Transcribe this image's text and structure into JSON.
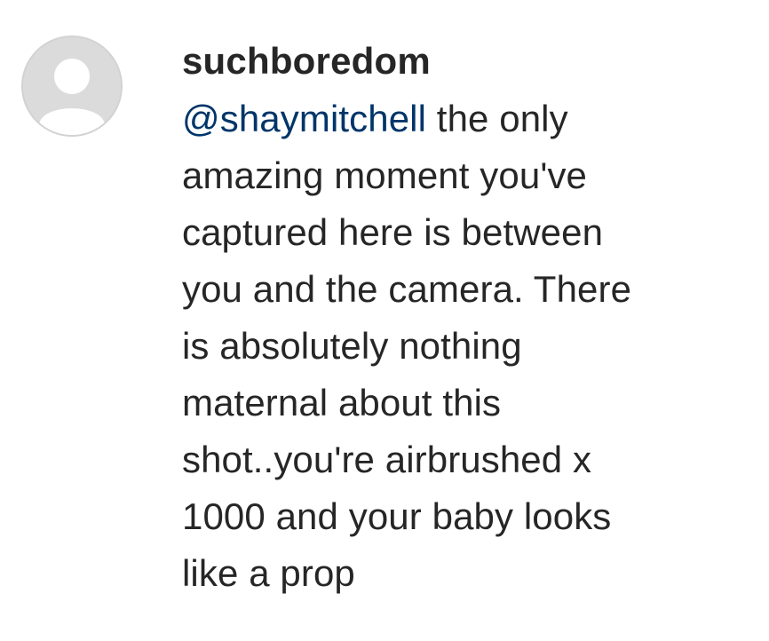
{
  "comment": {
    "username": "suchboredom",
    "mention": "@shaymitchell",
    "first_line_rest": " the only",
    "lines": [
      "amazing moment you've",
      "captured here is between",
      "you and the camera. There",
      "is absolutely nothing",
      "maternal about this",
      "shot..you're airbrushed x",
      "1000 and your baby looks",
      "like a prop"
    ]
  },
  "avatar": {
    "icon": "default-user-icon"
  },
  "colors": {
    "mention": "#003569",
    "text": "#262626",
    "avatar_bg": "#dbdbdb",
    "avatar_fg": "#ffffff"
  }
}
